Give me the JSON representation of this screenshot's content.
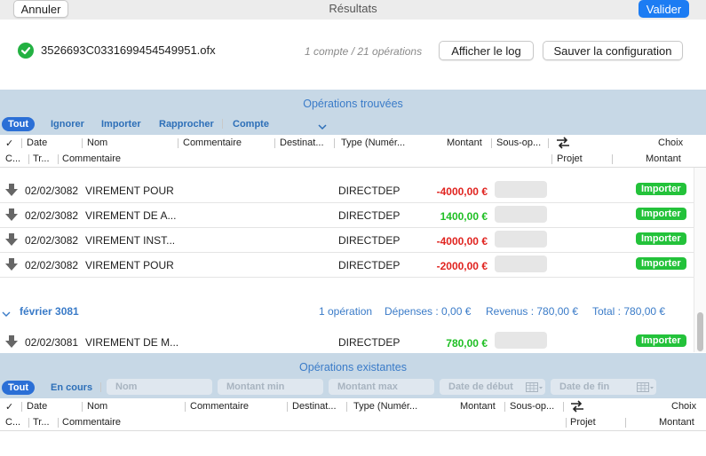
{
  "toolbar": {
    "cancel_label": "Annuler",
    "title": "Résultats",
    "validate_label": "Valider"
  },
  "file": {
    "name": "3526693C0331699454549951.ofx",
    "summary": "1 compte / 21 opérations",
    "show_log_label": "Afficher le log",
    "save_config_label": "Sauver la configuration"
  },
  "found_section": {
    "title": "Opérations trouvées",
    "tabs": [
      "Tout",
      "Ignorer",
      "Importer",
      "Rapprocher",
      "Compte"
    ],
    "headers_row1": [
      "✓",
      "Date",
      "Nom",
      "Commentaire",
      "Destinat...",
      "Type (Numér...",
      "Montant",
      "Sous-op...",
      "Choix"
    ],
    "headers_row2": [
      "C...",
      "Tr...",
      "Commentaire",
      "Projet",
      "Montant"
    ],
    "rows": [
      {
        "date": "02/02/3082",
        "name": "VIREMENT POUR",
        "type": "DIRECTDEP",
        "amount": "-4000,00 €",
        "sign": "neg",
        "action": "Importer"
      },
      {
        "date": "02/02/3082",
        "name": "VIREMENT DE A...",
        "type": "DIRECTDEP",
        "amount": "1400,00 €",
        "sign": "pos",
        "action": "Importer"
      },
      {
        "date": "02/02/3082",
        "name": "VIREMENT INST...",
        "type": "DIRECTDEP",
        "amount": "-4000,00 €",
        "sign": "neg",
        "action": "Importer"
      },
      {
        "date": "02/02/3082",
        "name": "VIREMENT POUR",
        "type": "DIRECTDEP",
        "amount": "-2000,00 €",
        "sign": "neg",
        "action": "Importer"
      }
    ],
    "group": {
      "label": "février 3081",
      "count": "1 opération",
      "expenses": "Dépenses : 0,00 €",
      "income": "Revenus : 780,00 €",
      "total": "Total : 780,00 €"
    },
    "group_rows": [
      {
        "date": "02/02/3081",
        "name": "VIREMENT DE M...",
        "type": "DIRECTDEP",
        "amount": "780,00 €",
        "sign": "pos",
        "action": "Importer"
      }
    ]
  },
  "existing_section": {
    "title": "Opérations existantes",
    "tabs": [
      "Tout",
      "En cours"
    ],
    "filters": {
      "name": "Nom",
      "amount_min": "Montant min",
      "amount_max": "Montant max",
      "start_date": "Date de début",
      "end_date": "Date de fin"
    },
    "headers_row1": [
      "✓",
      "Date",
      "Nom",
      "Commentaire",
      "Destinat...",
      "Type (Numér...",
      "Montant",
      "Sous-op...",
      "Choix"
    ],
    "headers_row2": [
      "C...",
      "Tr...",
      "Commentaire",
      "Projet",
      "Montant"
    ]
  },
  "colors": {
    "accent": "#1c7cf3",
    "section_bg": "#c7d8e6",
    "negative": "#e0231f",
    "positive": "#1fbf24",
    "import_button": "#23c23a"
  }
}
